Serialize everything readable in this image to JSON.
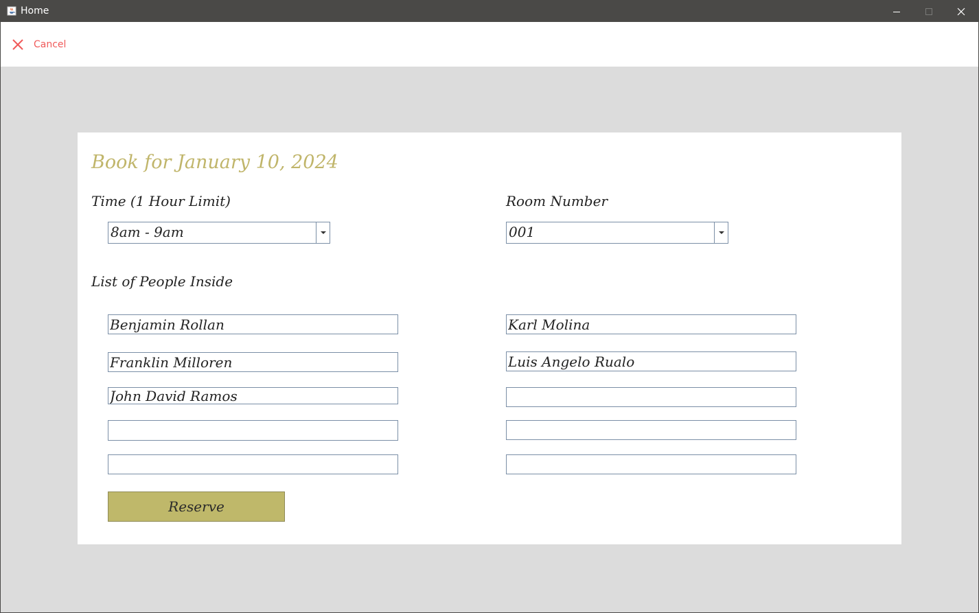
{
  "window": {
    "title": "Home"
  },
  "toolbar": {
    "cancel_label": "Cancel"
  },
  "form": {
    "heading": "Book for January 10, 2024",
    "time_label": "Time (1 Hour Limit)",
    "time_value": "8am - 9am",
    "room_label": "Room Number",
    "room_value": "001",
    "people_label": "List of People Inside",
    "people": {
      "left": [
        "Benjamin Rollan",
        "Franklin Milloren",
        "John David Ramos",
        "",
        ""
      ],
      "right": [
        "Karl Molina",
        "Luis Angelo Rualo",
        "",
        "",
        ""
      ]
    },
    "reserve_label": "Reserve"
  },
  "colors": {
    "titlebar": "#4a4947",
    "background": "#dcdcdc",
    "accent_title": "#c0b56a",
    "reserve_button": "#bfb86a",
    "cancel": "#f05a5a",
    "field_border": "#7a8ea6"
  },
  "icons": {
    "app": "java-cup-icon",
    "minimize": "minimize-icon",
    "maximize": "maximize-icon",
    "close": "close-icon",
    "cancel": "x-icon",
    "dropdown": "dropdown-arrow-icon"
  }
}
